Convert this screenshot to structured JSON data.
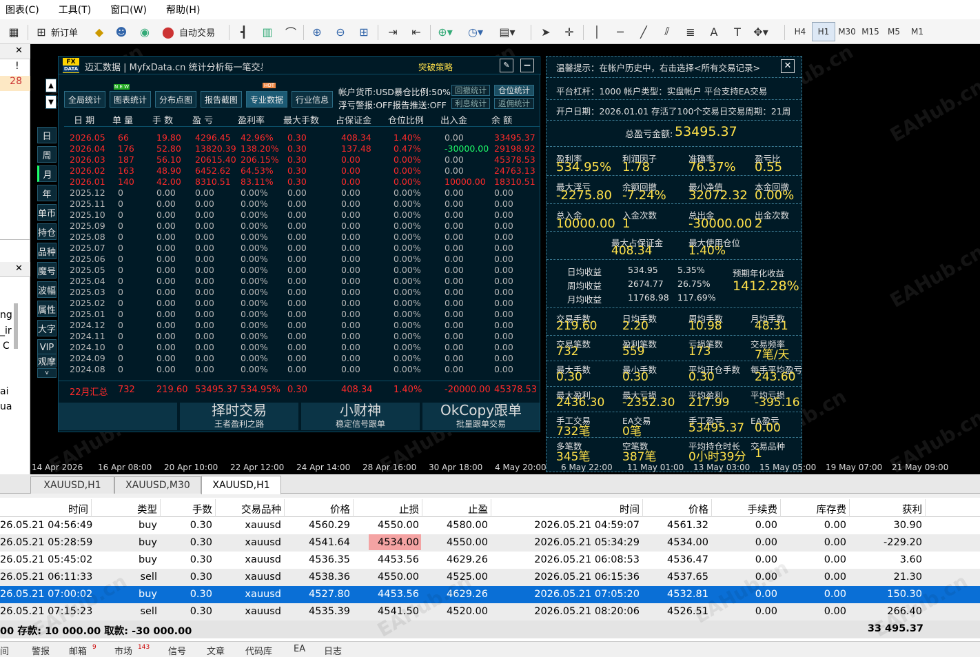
{
  "menu": [
    "图表(C)",
    "工具(T)",
    "窗口(W)",
    "帮助(H)"
  ],
  "toolbar": {
    "new_order": "新订单",
    "auto_trade": "自动交易",
    "timeframes": [
      "H4",
      "H1",
      "M30",
      "M15",
      "M5",
      "M1"
    ],
    "active_timeframe": "H1"
  },
  "left": {
    "val1": "!",
    "val2": "28",
    "frag": [
      "ng",
      "_ir",
      "C",
      "ai",
      "ua"
    ]
  },
  "panel": {
    "title": "迈汇数据 | MyfxData.cn  统计分析每一笔交易",
    "brand": "突破策略",
    "logo_top": "FX",
    "logo_bottom": "DATA",
    "buttons": [
      "全局统计",
      "图表统计",
      "分布点图",
      "报告截图",
      "专业数据",
      "行业信息"
    ],
    "new_badge": "N E W",
    "hot_badge": "HOT",
    "info1": "帐户货币:USD暴仓比例:50%",
    "info2": "浮亏警报:OFF报告推送:OFF",
    "small_buttons": [
      "回撤统计",
      "仓位统计",
      "利息统计",
      "返佣统计"
    ],
    "side": [
      "日",
      "周",
      "月",
      "年",
      "单币",
      "持仓",
      "品种",
      "魔号",
      "波幅",
      "属性",
      "大字",
      "VIP",
      "观摩"
    ],
    "headers": [
      "日 期",
      "单 量",
      "手 数",
      "盈 亏",
      "盈利率",
      "最大手数",
      "占保证金",
      "仓位比例",
      "出入金",
      "余 额"
    ],
    "rows": [
      [
        "2026.05",
        "66",
        "19.80",
        "4296.45",
        "42.96%",
        "0.30",
        "408.34",
        "1.40%",
        "0.00",
        "33495.37"
      ],
      [
        "2026.04",
        "176",
        "52.80",
        "13820.39",
        "138.20%",
        "0.30",
        "137.48",
        "0.47%",
        "-30000.00",
        "29198.92"
      ],
      [
        "2026.03",
        "187",
        "56.10",
        "20615.40",
        "206.15%",
        "0.30",
        "0.00",
        "0.00%",
        "0.00",
        "45378.53"
      ],
      [
        "2026.02",
        "163",
        "48.90",
        "6452.62",
        "64.53%",
        "0.30",
        "0.00",
        "0.00%",
        "0.00",
        "24763.13"
      ],
      [
        "2026.01",
        "140",
        "42.00",
        "8310.51",
        "83.11%",
        "0.30",
        "0.00",
        "0.00%",
        "10000.00",
        "18310.51"
      ],
      [
        "2025.12",
        "0",
        "0.00",
        "0.00",
        "0.00%",
        "0.00",
        "0.00",
        "0.00%",
        "0.00",
        "0.00"
      ],
      [
        "2025.11",
        "0",
        "0.00",
        "0.00",
        "0.00%",
        "0.00",
        "0.00",
        "0.00%",
        "0.00",
        "0.00"
      ],
      [
        "2025.10",
        "0",
        "0.00",
        "0.00",
        "0.00%",
        "0.00",
        "0.00",
        "0.00%",
        "0.00",
        "0.00"
      ],
      [
        "2025.09",
        "0",
        "0.00",
        "0.00",
        "0.00%",
        "0.00",
        "0.00",
        "0.00%",
        "0.00",
        "0.00"
      ],
      [
        "2025.08",
        "0",
        "0.00",
        "0.00",
        "0.00%",
        "0.00",
        "0.00",
        "0.00%",
        "0.00",
        "0.00"
      ],
      [
        "2025.07",
        "0",
        "0.00",
        "0.00",
        "0.00%",
        "0.00",
        "0.00",
        "0.00%",
        "0.00",
        "0.00"
      ],
      [
        "2025.06",
        "0",
        "0.00",
        "0.00",
        "0.00%",
        "0.00",
        "0.00",
        "0.00%",
        "0.00",
        "0.00"
      ],
      [
        "2025.05",
        "0",
        "0.00",
        "0.00",
        "0.00%",
        "0.00",
        "0.00",
        "0.00%",
        "0.00",
        "0.00"
      ],
      [
        "2025.04",
        "0",
        "0.00",
        "0.00",
        "0.00%",
        "0.00",
        "0.00",
        "0.00%",
        "0.00",
        "0.00"
      ],
      [
        "2025.03",
        "0",
        "0.00",
        "0.00",
        "0.00%",
        "0.00",
        "0.00",
        "0.00%",
        "0.00",
        "0.00"
      ],
      [
        "2025.02",
        "0",
        "0.00",
        "0.00",
        "0.00%",
        "0.00",
        "0.00",
        "0.00%",
        "0.00",
        "0.00"
      ],
      [
        "2025.01",
        "0",
        "0.00",
        "0.00",
        "0.00%",
        "0.00",
        "0.00",
        "0.00%",
        "0.00",
        "0.00"
      ],
      [
        "2024.12",
        "0",
        "0.00",
        "0.00",
        "0.00%",
        "0.00",
        "0.00",
        "0.00%",
        "0.00",
        "0.00"
      ],
      [
        "2024.11",
        "0",
        "0.00",
        "0.00",
        "0.00%",
        "0.00",
        "0.00",
        "0.00%",
        "0.00",
        "0.00"
      ],
      [
        "2024.10",
        "0",
        "0.00",
        "0.00",
        "0.00%",
        "0.00",
        "0.00",
        "0.00%",
        "0.00",
        "0.00"
      ],
      [
        "2024.09",
        "0",
        "0.00",
        "0.00",
        "0.00%",
        "0.00",
        "0.00",
        "0.00%",
        "0.00",
        "0.00"
      ],
      [
        "2024.08",
        "0",
        "0.00",
        "0.00",
        "0.00%",
        "0.00",
        "0.00",
        "0.00%",
        "0.00",
        "0.00"
      ]
    ],
    "summary": [
      "22月汇总",
      "732",
      "219.60",
      "53495.37",
      "534.95%",
      "0.30",
      "408.34",
      "1.40%",
      "-20000.00",
      "45378.53"
    ],
    "promo": [
      {
        "big": "择时交易",
        "small": "王者盈利之路"
      },
      {
        "big": "小财神",
        "small": "稳定信号跟单"
      },
      {
        "big": "OkCopy跟单",
        "small": "批量跟单交易"
      }
    ]
  },
  "right": {
    "tip": "温馨提示：在帐户历史中，右击选择<所有交易记录>",
    "line1": "平台杠杆：1000   帐户类型：实盘帐户    平台支持EA交易",
    "line2": "开户日期：2026.01.01 存活了100个交易日交易周期：21周",
    "total_label": "总盈亏金额:",
    "total_value": "53495.37",
    "grid": [
      [
        {
          "l": "盈利率",
          "v": "534.95%"
        },
        {
          "l": "利润因子",
          "v": "1.78"
        },
        {
          "l": "准确率",
          "v": "76.37%"
        },
        {
          "l": "盈亏比",
          "v": "0.55"
        }
      ],
      [
        {
          "l": "最大浮亏",
          "v": "-2275.80"
        },
        {
          "l": "余额回撤",
          "v": "-7.24%"
        },
        {
          "l": "最小净值",
          "v": "32072.32"
        },
        {
          "l": "本金回撤",
          "v": "0.00%"
        }
      ],
      [
        {
          "l": "总入金",
          "v": "10000.00"
        },
        {
          "l": "入金次数",
          "v": "1"
        },
        {
          "l": "总出金",
          "v": "-30000.00"
        },
        {
          "l": "出金次数",
          "v": "2"
        }
      ]
    ],
    "margin": [
      {
        "l": "最大占保证金",
        "v": "408.34"
      },
      {
        "l": "最大使用仓位",
        "v": "1.40%"
      }
    ],
    "avg": [
      {
        "l": "日均收益",
        "a": "534.95",
        "b": "5.35%"
      },
      {
        "l": "周均收益",
        "a": "2674.77",
        "b": "26.75%"
      },
      {
        "l": "月均收益",
        "a": "11768.98",
        "b": "117.69%"
      }
    ],
    "annual_label": "预期年化收益",
    "annual_value": "1412.28%",
    "grid2": [
      [
        {
          "l": "交易手数",
          "v": "219.60"
        },
        {
          "l": "日均手数",
          "v": "2.20"
        },
        {
          "l": "周均手数",
          "v": "10.98"
        },
        {
          "l": "月均手数",
          "v": "48.31"
        }
      ],
      [
        {
          "l": "交易笔数",
          "v": "732"
        },
        {
          "l": "盈利笔数",
          "v": "559"
        },
        {
          "l": "亏损笔数",
          "v": "173"
        },
        {
          "l": "交易频率",
          "v": "7笔/天"
        }
      ],
      [
        {
          "l": "最大手数",
          "v": "0.30"
        },
        {
          "l": "最小手数",
          "v": "0.30"
        },
        {
          "l": "平均开仓手数",
          "v": "0.30"
        },
        {
          "l": "每手平均盈亏",
          "v": "243.60"
        }
      ],
      [
        {
          "l": "最大盈利",
          "v": "2436.30"
        },
        {
          "l": "最大亏损",
          "v": "-2352.30"
        },
        {
          "l": "平均盈利",
          "v": "217.99"
        },
        {
          "l": "平均亏损",
          "v": "-395.16"
        }
      ],
      [
        {
          "l": "手工交易",
          "v": "732笔"
        },
        {
          "l": "EA交易",
          "v": "0笔"
        },
        {
          "l": "手工盈亏",
          "v": "53495.37"
        },
        {
          "l": "EA盈亏",
          "v": "0.00"
        }
      ],
      [
        {
          "l": "多笔数",
          "v": "345笔"
        },
        {
          "l": "空笔数",
          "v": "387笔"
        },
        {
          "l": "平均持仓时长",
          "v": "0小时39分"
        },
        {
          "l": "交易品种",
          "v": "1"
        }
      ]
    ]
  },
  "xaxis": [
    "14 Apr 2026",
    "16 Apr 08:00",
    "20 Apr 10:00",
    "22 Apr 12:00",
    "24 Apr 14:00",
    "28 Apr 16:00",
    "30 Apr 18:00",
    "4 May 20:00",
    "6 May 22:00",
    "11 May 01:00",
    "13 May 03:00",
    "15 May 05:00",
    "19 May 07:00",
    "21 May 09:00"
  ],
  "chart_tabs": [
    "XAUUSD,H1",
    "XAUUSD,M30",
    "XAUUSD,H1"
  ],
  "table": {
    "headers": [
      "时间",
      "类型",
      "手数",
      "交易品种",
      "价格",
      "止损",
      "止盈",
      "时间",
      "价格",
      "手续费",
      "库存费",
      "获利"
    ],
    "rows": [
      [
        "26.05.21 04:56:49",
        "buy",
        "0.30",
        "xauusd",
        "4560.29",
        "4550.00",
        "4580.00",
        "2026.05.21 04:59:07",
        "4561.32",
        "0.00",
        "0.00",
        "30.90"
      ],
      [
        "26.05.21 05:28:59",
        "buy",
        "0.30",
        "xauusd",
        "4541.64",
        "4534.00",
        "4550.00",
        "2026.05.21 05:34:29",
        "4534.00",
        "0.00",
        "0.00",
        "-229.20"
      ],
      [
        "26.05.21 05:45:02",
        "buy",
        "0.30",
        "xauusd",
        "4536.35",
        "4453.56",
        "4629.26",
        "2026.05.21 06:08:53",
        "4536.47",
        "0.00",
        "0.00",
        "3.60"
      ],
      [
        "26.05.21 06:11:33",
        "sell",
        "0.30",
        "xauusd",
        "4538.36",
        "4550.00",
        "4525.00",
        "2026.05.21 06:15:36",
        "4537.65",
        "0.00",
        "0.00",
        "21.30"
      ],
      [
        "26.05.21 07:00:02",
        "buy",
        "0.30",
        "xauusd",
        "4527.80",
        "4453.56",
        "4629.26",
        "2026.05.21 07:05:20",
        "4532.81",
        "0.00",
        "0.00",
        "150.30"
      ],
      [
        "26.05.21 07:15:23",
        "sell",
        "0.30",
        "xauusd",
        "4535.39",
        "4541.50",
        "4520.00",
        "2026.05.21 08:20:06",
        "4526.51",
        "0.00",
        "0.00",
        "266.40"
      ]
    ],
    "footer_left": "00  存款: 10 000.00  取款: -30 000.00",
    "footer_right": "33 495.37"
  },
  "bottom_tabs": [
    "间",
    "警报",
    "邮箱",
    "市场",
    "信号",
    "文章",
    "代码库",
    "EA",
    "日志"
  ],
  "bottom_badges": {
    "mail": "9",
    "market": "143"
  },
  "watermark": "EAHub.cn",
  "colors": {
    "chart_bg": "#000000",
    "panel_bg": "#001a26",
    "positive": "#ff2a2a",
    "value": "#ffe14a",
    "selected_row": "#0a6fd6",
    "stop_hit": "#f4a3a3"
  }
}
